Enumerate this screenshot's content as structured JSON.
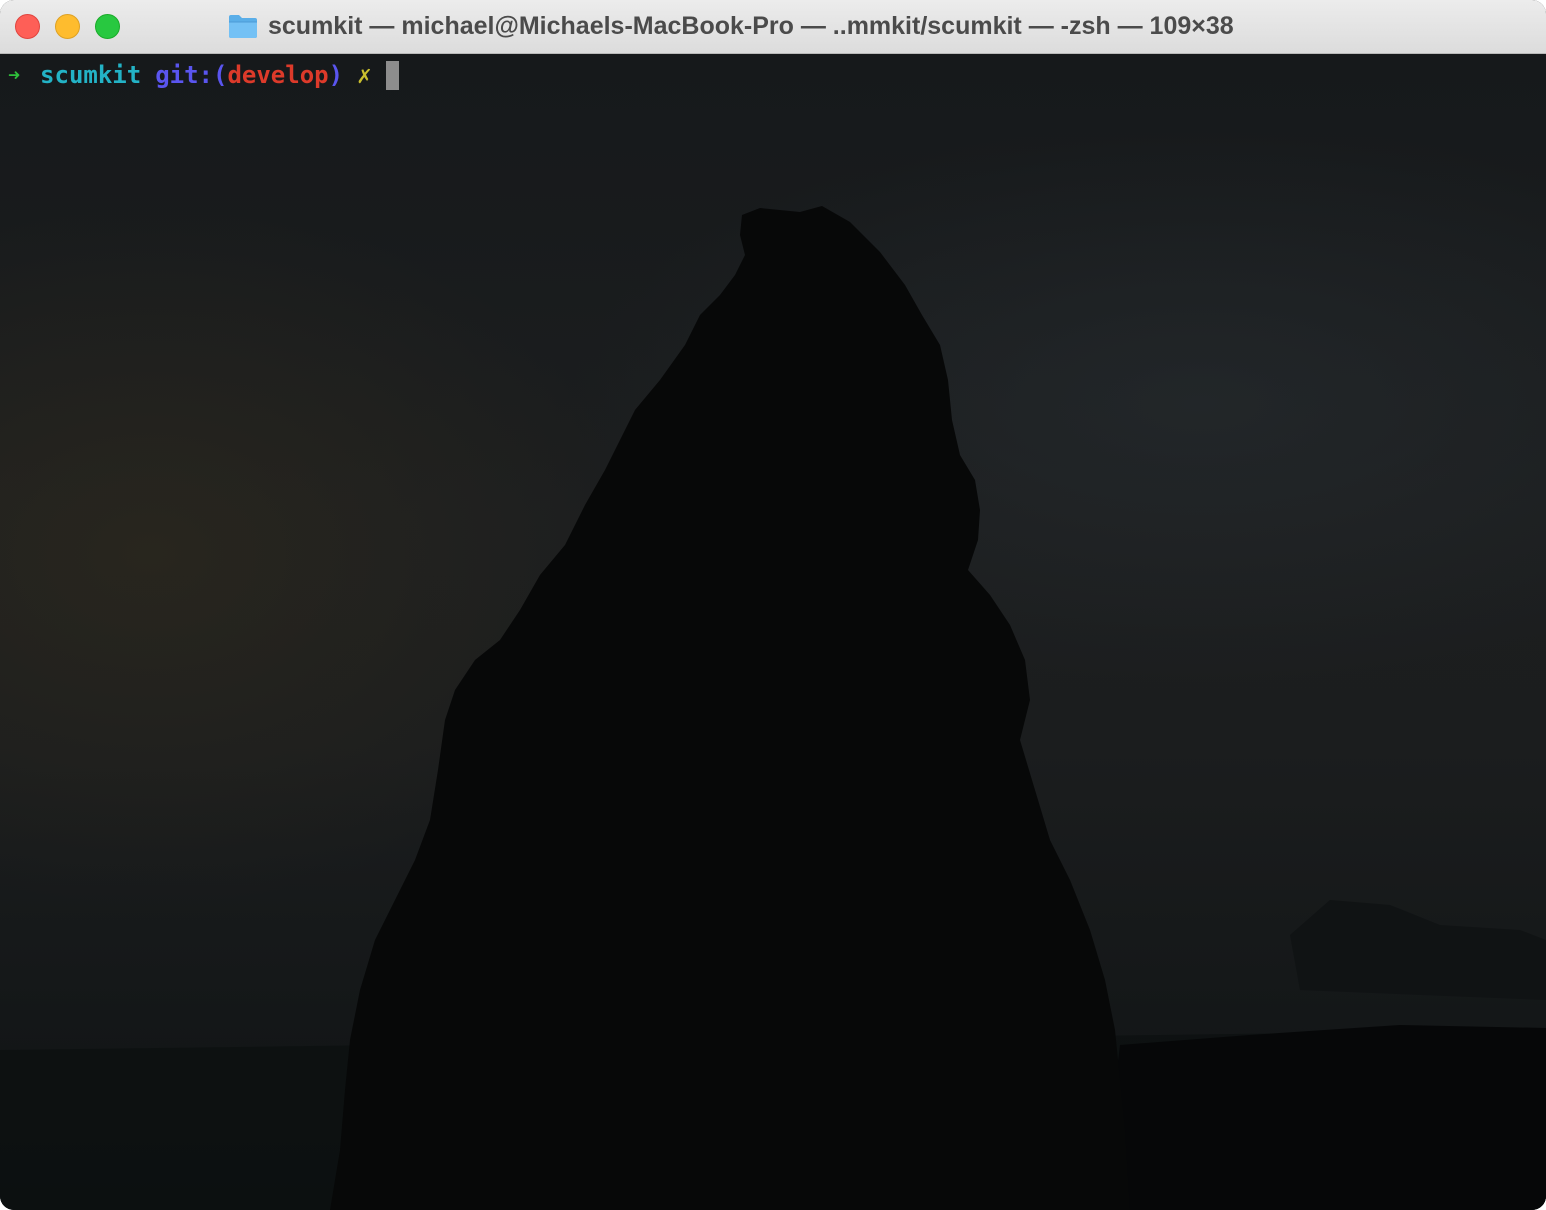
{
  "window": {
    "title": "scumkit — michael@Michaels-MacBook-Pro — ..mmkit/scumkit — -zsh — 109×38",
    "title_icon": "folder-icon",
    "buttons": [
      "close",
      "minimize",
      "zoom"
    ]
  },
  "terminal": {
    "prompt_arrow": "➜",
    "directory": "scumkit",
    "git_prefix": "git:(",
    "branch": "develop",
    "git_suffix": ")",
    "dirty_marker": "✗",
    "colors": {
      "arrow": "#2fbf3b",
      "directory": "#23b3c6",
      "git": "#5a55ef",
      "branch": "#dd3a2a",
      "dirty": "#c9bf2e",
      "cursor": "#8d8d8d"
    }
  }
}
